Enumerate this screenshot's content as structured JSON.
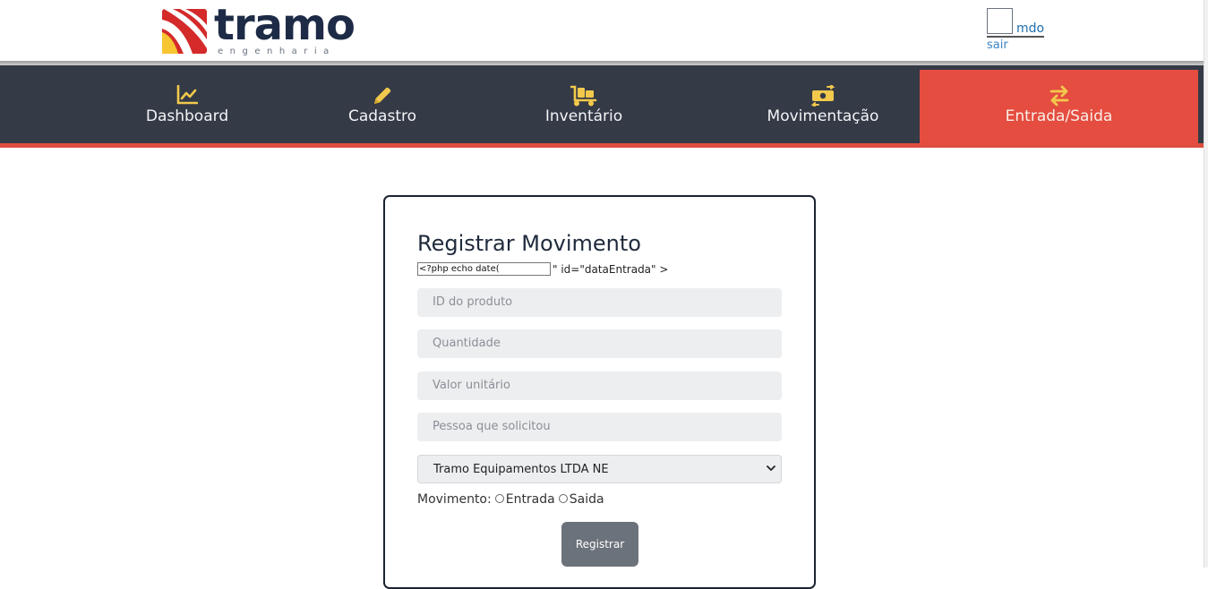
{
  "header": {
    "brand": "tramo",
    "brand_sub": "engenharia",
    "user_name": "mdo",
    "logout_label": "sair"
  },
  "nav": {
    "items": [
      {
        "label": "Dashboard",
        "icon": "chart-line-icon"
      },
      {
        "label": "Cadastro",
        "icon": "pencil-icon"
      },
      {
        "label": "Inventário",
        "icon": "dolly-icon"
      },
      {
        "label": "Movimentação",
        "icon": "money-exchange-icon"
      },
      {
        "label": "Entrada/Saida",
        "icon": "arrows-exchange-icon",
        "active": true
      }
    ],
    "icon_color": "#f2c94c",
    "bar_color": "#343a46",
    "active_color": "#e44d3f"
  },
  "form": {
    "title": "Registrar Movimento",
    "date_input_value": "<?php echo date(",
    "date_tail": "\" id=\"dataEntrada\" >",
    "fields": [
      {
        "placeholder": "ID do produto"
      },
      {
        "placeholder": "Quantidade"
      },
      {
        "placeholder": "Valor unitário"
      },
      {
        "placeholder": "Pessoa que solicitou"
      }
    ],
    "company_select": "Tramo Equipamentos LTDA NE",
    "movement_label": "Movimento:",
    "option_in": "Entrada",
    "option_out": "Saida",
    "submit_label": "Registrar"
  }
}
